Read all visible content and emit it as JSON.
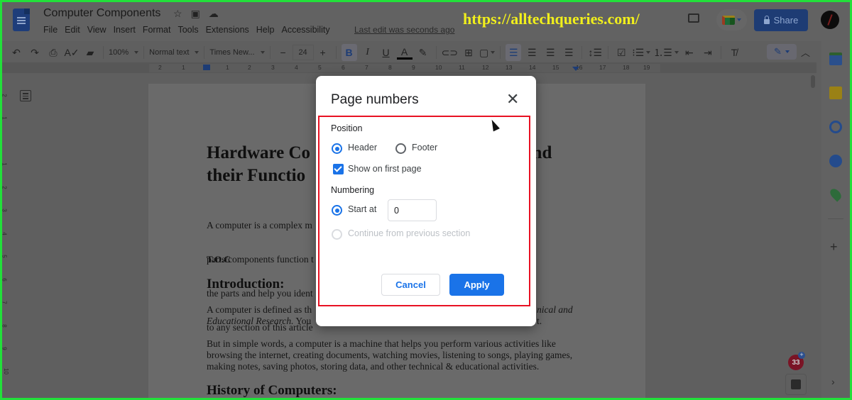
{
  "app": {
    "doc_title": "Computer Components",
    "title_icons": [
      "star-icon",
      "move-to-folder-icon",
      "cloud-saved-icon"
    ],
    "menu": [
      "File",
      "Edit",
      "View",
      "Insert",
      "Format",
      "Tools",
      "Extensions",
      "Help",
      "Accessibility"
    ],
    "last_edit": "Last edit was seconds ago",
    "watermark": "https://alltechqueries.com/",
    "share_label": "Share"
  },
  "toolbar": {
    "zoom": "100%",
    "style": "Normal text",
    "font": "Times New...",
    "font_size": "24",
    "minus": "−",
    "plus": "+",
    "bold": "B",
    "italic": "I",
    "underline": "U",
    "text_color": "A"
  },
  "ruler": {
    "marks": [
      "2",
      "1",
      "1",
      "2",
      "3",
      "4",
      "5",
      "6",
      "7",
      "8",
      "9",
      "10",
      "11",
      "12",
      "13",
      "14",
      "15",
      "16",
      "17",
      "18",
      "19"
    ],
    "vertical_marks": [
      "2",
      "1",
      "1",
      "2",
      "3",
      "4",
      "5",
      "6",
      "7",
      "8",
      "9",
      "10"
    ]
  },
  "document": {
    "title_line1": "Hardware Co                                                  nd",
    "title_line2": "their Functio",
    "intro_para": [
      "A computer is a complex m                                                         ese",
      "parts/components function t                                                       describe all",
      "the parts and help you ident                                                      low to jump",
      "to any section of this article"
    ],
    "toc": "T.O.C",
    "introduction_heading": "Introduction:",
    "def_para_line1_left": "A computer is defined as th",
    "def_para_line1_right": "nical and",
    "def_para_line2_left": "Educational Research.",
    "def_para_line2_mid": " You",
    "def_para_line2_right": "t.",
    "simple_para": [
      "But in simple words, a computer is a machine that helps you perform various activities like",
      "browsing the internet, creating documents, watching movies, listening to songs, playing games,",
      "making notes, saving photos, storing data, and other technical & educational activities."
    ],
    "history_heading": "History of Computers:"
  },
  "dialog": {
    "title": "Page numbers",
    "position_label": "Position",
    "header_label": "Header",
    "footer_label": "Footer",
    "position_selected": "Header",
    "show_first_page_label": "Show on first page",
    "show_first_page_checked": true,
    "numbering_label": "Numbering",
    "start_at_label": "Start at",
    "start_at_value": "0",
    "continue_label": "Continue from previous section",
    "numbering_selected": "Start at",
    "cancel_label": "Cancel",
    "apply_label": "Apply"
  },
  "side_panel": {
    "apps": [
      "calendar-icon",
      "keep-icon",
      "tasks-icon",
      "contacts-icon",
      "maps-icon"
    ],
    "add_label": "+",
    "badge_count": "33"
  },
  "colors": {
    "accent": "#1a73e8",
    "highlight_box": "#e81123",
    "frame": "#22e03a",
    "watermark": "#f1ef1c"
  }
}
